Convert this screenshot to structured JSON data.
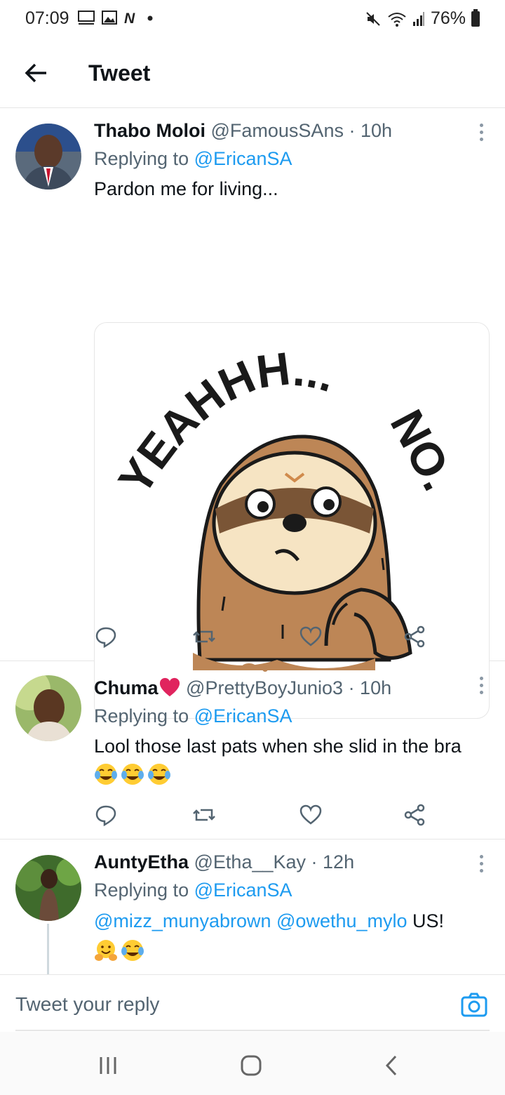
{
  "status_bar": {
    "time": "07:09",
    "battery": "76%"
  },
  "header": {
    "title": "Tweet"
  },
  "tweets": [
    {
      "name": "Thabo Moloi",
      "handle": "@FamousSAns",
      "age": "· 10h",
      "reply_prefix": "Replying to",
      "reply_to": "@EricanSA",
      "text": "Pardon me for living...",
      "media_caption_top": "YEAHHH...",
      "media_caption_right": "NO."
    },
    {
      "name": "Chuma",
      "handle": "@PrettyBoyJunio3",
      "age": "· 10h",
      "reply_prefix": "Replying to",
      "reply_to": "@EricanSA",
      "text": "Lool those last pats when she slid in the bra"
    },
    {
      "name": "AuntyEtha",
      "handle": "@Etha__Kay",
      "age": "· 12h",
      "reply_prefix": "Replying to",
      "reply_to": "@EricanSA",
      "mention1": "@mizz_munyabrown",
      "mention2": "@owethu_mylo",
      "text": "US!"
    }
  ],
  "composer": {
    "placeholder": "Tweet your reply"
  },
  "icons": {
    "back": "arrow-left-icon",
    "reply": "reply-icon",
    "retweet": "retweet-icon",
    "like": "heart-icon",
    "share": "share-icon",
    "more": "more-vertical-icon",
    "camera": "camera-icon"
  },
  "colors": {
    "accent": "#1d9bf0",
    "secondary_text": "#536471",
    "heart": "#e0245e"
  }
}
